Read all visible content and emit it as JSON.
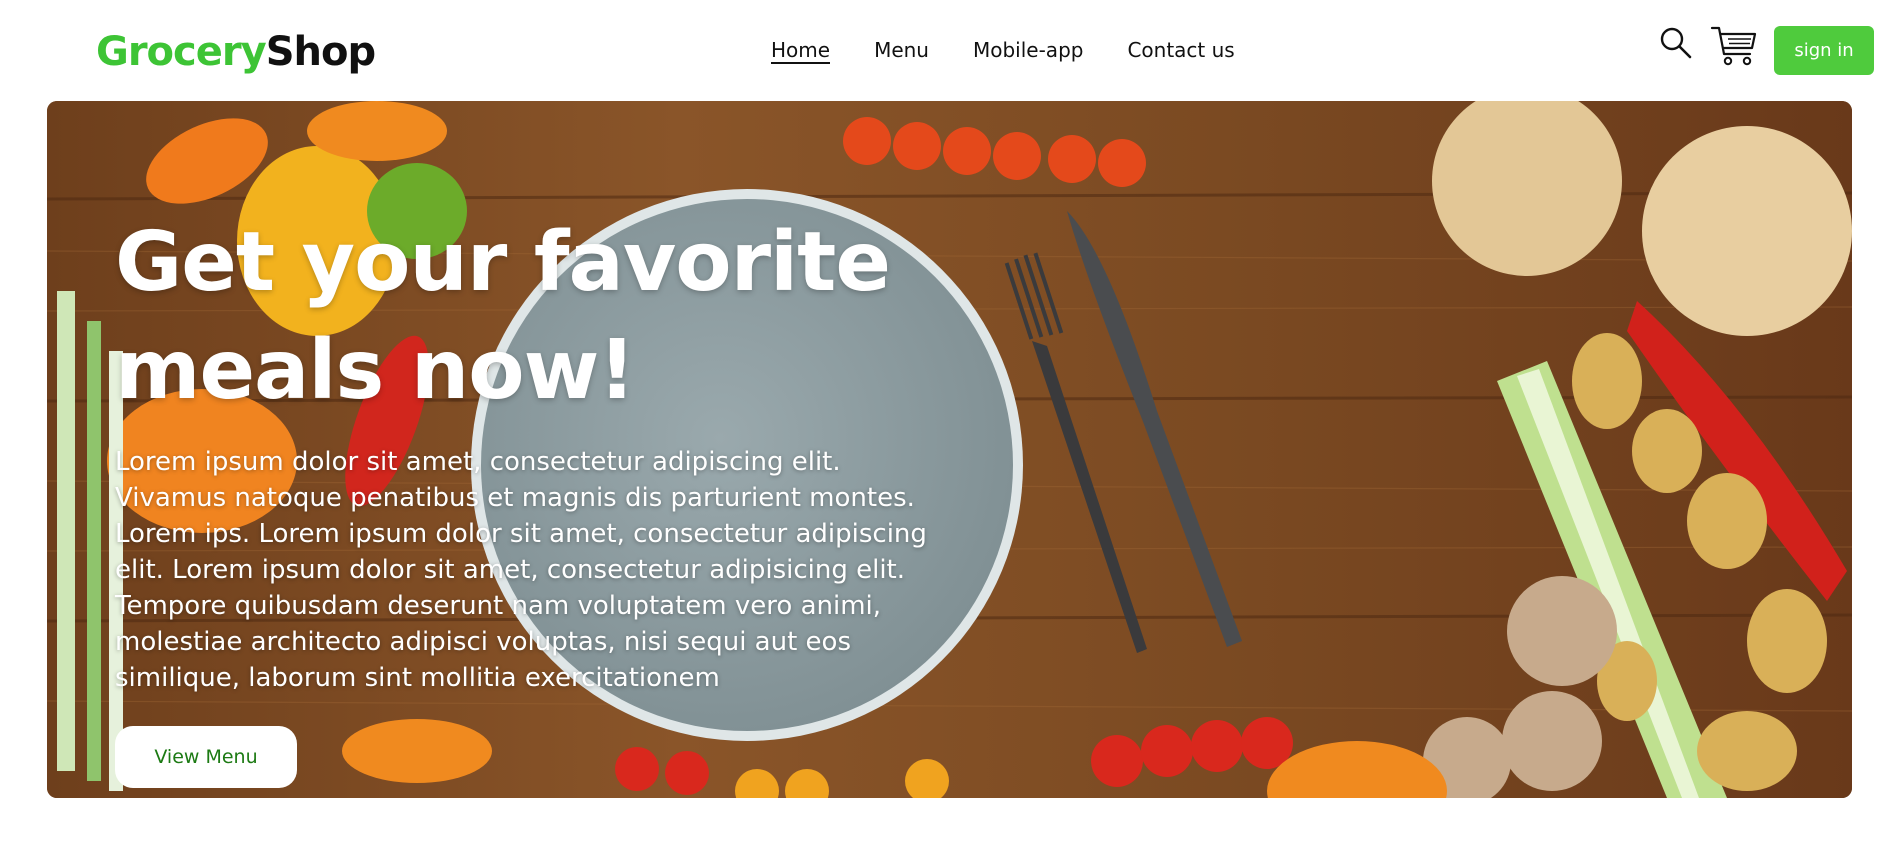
{
  "brand": {
    "part1": "Grocery",
    "part2": "Shop"
  },
  "nav": {
    "items": [
      {
        "label": "Home",
        "active": true
      },
      {
        "label": "Menu",
        "active": false
      },
      {
        "label": "Mobile-app",
        "active": false
      },
      {
        "label": "Contact us",
        "active": false
      }
    ]
  },
  "header_actions": {
    "search_icon": "search-icon",
    "cart_icon": "cart-icon",
    "signin_label": "sign in"
  },
  "hero": {
    "title": "Get your favorite meals now!",
    "body": "Lorem ipsum dolor sit amet, consectetur adipiscing elit. Vivamus natoque penatibus et magnis dis parturient montes. Lorem ips. Lorem ipsum dolor sit amet, consectetur adipiscing elit. Lorem ipsum dolor sit amet, consectetur adipisicing elit. Tempore quibusdam deserunt nam voluptatem vero animi, molestiae architecto adipisci voluptas, nisi sequi aut eos similique, laborum sint mollitia exercitationem",
    "cta_label": "View Menu"
  },
  "colors": {
    "brand_green": "#3dc435",
    "signin_green": "#4fcb3d",
    "cta_text": "#1c7a13",
    "wood": "#7a4a24"
  }
}
